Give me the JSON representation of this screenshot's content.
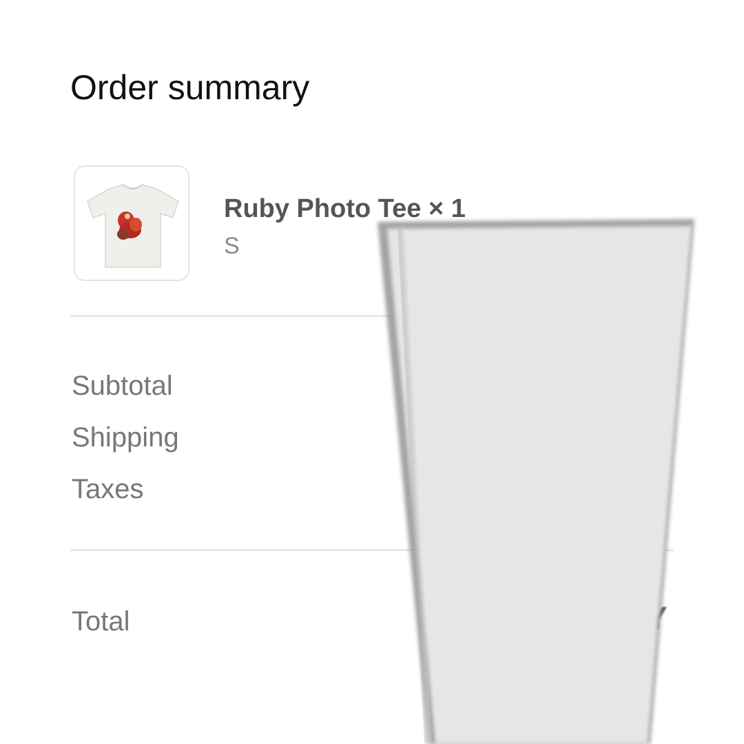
{
  "order": {
    "title": "Order summary",
    "item": {
      "name": "Ruby Photo Tee × 1",
      "variant": "S",
      "image": "tshirt-thumbnail"
    },
    "summary": {
      "subtotal_label": "Subtotal",
      "shipping_label": "Shipping",
      "taxes_label": "Taxes",
      "total_label": "Total",
      "total_value_partial": "Y"
    }
  },
  "colors": {
    "background": "#ffffff",
    "title_text": "#111111",
    "label_text": "#777777",
    "divider": "#e8e8e8",
    "redaction_fill": "#e6e6e6"
  }
}
